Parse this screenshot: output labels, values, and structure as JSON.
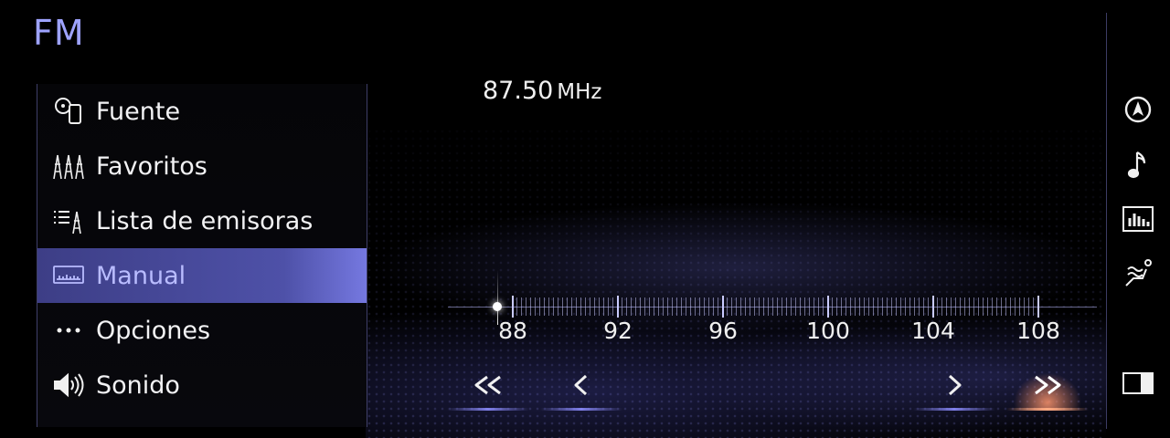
{
  "header": {
    "title": "FM"
  },
  "menu": {
    "items": [
      {
        "label": "Fuente",
        "icon": "source-icon"
      },
      {
        "label": "Favoritos",
        "icon": "favorites-antenna-icon"
      },
      {
        "label": "Lista de emisoras",
        "icon": "station-list-icon"
      },
      {
        "label": "Manual",
        "icon": "manual-tuning-icon",
        "active": true
      },
      {
        "label": "Opciones",
        "icon": "more-dots-icon"
      },
      {
        "label": "Sonido",
        "icon": "speaker-icon"
      }
    ]
  },
  "tuner": {
    "frequency": "87.50",
    "unit": "MHz",
    "scale_labels": [
      "88",
      "92",
      "96",
      "100",
      "104",
      "108"
    ],
    "current_value": 87.5
  },
  "controls": {
    "seek_back": "seek-back-icon",
    "step_back": "step-back-icon",
    "step_forward": "step-forward-icon",
    "seek_forward": "seek-forward-icon"
  },
  "side_buttons": [
    "navigation-icon",
    "music-note-icon",
    "equalizer-icon",
    "seat-climate-icon",
    "split-screen-icon"
  ],
  "colors": {
    "accent": "#9ea3ff",
    "active_row": "#4e51a8",
    "highlight": "#ff9a70"
  }
}
